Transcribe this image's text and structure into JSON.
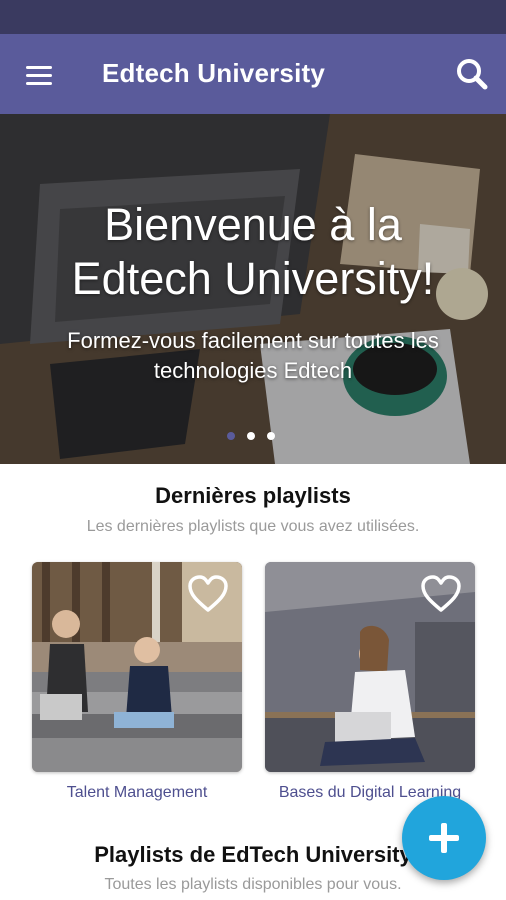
{
  "app_bar": {
    "title": "Edtech University",
    "menu_icon": "hamburger-menu-icon",
    "search_icon": "search-icon",
    "color": "#5a5b9b"
  },
  "hero": {
    "title_line1": "Bienvenue à la",
    "title_line2": "Edtech University!",
    "subtitle_line1": "Formez-vous facilement sur toutes les",
    "subtitle_line2": "technologies Edtech",
    "carousel": {
      "count": 3,
      "active_index": 0
    }
  },
  "latest_playlists": {
    "title": "Dernières playlists",
    "subtitle": "Les dernières playlists que vous avez utilisées.",
    "items": [
      {
        "label": "Talent Management",
        "favorite_icon": "heart-outline-icon"
      },
      {
        "label": "Bases du Digital Learning",
        "favorite_icon": "heart-outline-icon"
      }
    ]
  },
  "all_playlists": {
    "title": "Playlists de EdTech University",
    "subtitle": "Toutes les playlists disponibles pour vous."
  },
  "fab": {
    "icon": "plus-icon",
    "color": "#21a5dc"
  }
}
